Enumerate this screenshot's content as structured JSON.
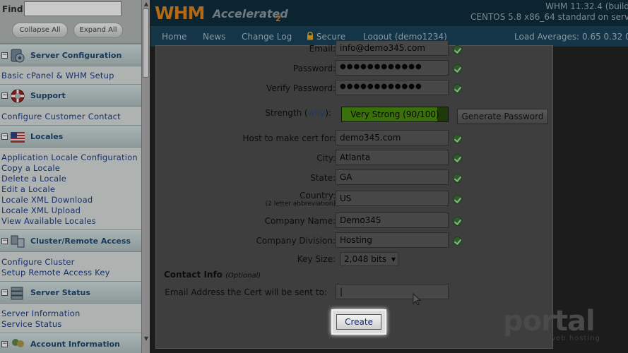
{
  "sidebar": {
    "find_label": "Find",
    "find_value": "",
    "collapse_all": "Collapse All",
    "expand_all": "Expand All",
    "sections": [
      {
        "title": "Server Configuration",
        "icon": "server-config-icon",
        "links": [
          "Basic cPanel & WHM Setup"
        ]
      },
      {
        "title": "Support",
        "icon": "lifebuoy-icon",
        "links": [
          "Configure Customer Contact"
        ]
      },
      {
        "title": "Locales",
        "icon": "us-flag-icon",
        "links": [
          "Application Locale Configuration",
          "Copy a Locale",
          "Delete a Locale",
          "Edit a Locale",
          "Locale XML Download",
          "Locale XML Upload",
          "View Available Locales"
        ]
      },
      {
        "title": "Cluster/Remote Access",
        "icon": "cluster-icon",
        "links": [
          "Configure Cluster",
          "Setup Remote Access Key"
        ]
      },
      {
        "title": "Server Status",
        "icon": "server-status-icon",
        "links": [
          "Server Information",
          "Service Status"
        ]
      },
      {
        "title": "Account Information",
        "icon": "account-info-icon",
        "links": []
      }
    ]
  },
  "header": {
    "logo_main": "WHM",
    "logo_sub": "Accelerated",
    "logo_num": "2",
    "version_line1": "WHM 11.32.4 (build",
    "version_line2": "CENTOS 5.8 x86_64 standard on serv"
  },
  "nav": {
    "items": [
      "Home",
      "News",
      "Change Log",
      "Secure",
      "Logout (demo1234)"
    ],
    "load_averages": "Load Averages: 0.65 0.32 0"
  },
  "form": {
    "email_label": "Email:",
    "email_value": "info@demo345.com",
    "password_label": "Password:",
    "password_value": "●●●●●●●●●●●●",
    "verify_label": "Verify Password:",
    "verify_value": "●●●●●●●●●●●●",
    "strength_label": "Strength (",
    "strength_why": "why",
    "strength_close": "):",
    "strength_text": "Very Strong (90/100)",
    "strength_level": 0.9,
    "generate_button": "Generate Password",
    "host_label": "Host to make cert for:",
    "host_value": "demo345.com",
    "city_label": "City:",
    "city_value": "Atlanta",
    "state_label": "State:",
    "state_value": "GA",
    "country_label": "Country:",
    "country_note": "(2 letter abbreviation)",
    "country_value": "US",
    "company_label": "Company Name:",
    "company_value": "Demo345",
    "division_label": "Company Division:",
    "division_value": "Hosting",
    "keysize_label": "Key Size:",
    "keysize_value": "2,048 bits",
    "contact_title": "Contact Info",
    "contact_optional": "(Optional)",
    "cert_email_label": "Email Address the Cert will be sent to:",
    "cert_email_value": "|",
    "create_button": "Create"
  },
  "watermark": {
    "brand": "portal",
    "tagline": "web hosting"
  },
  "colors": {
    "header_bg": "#0c2330",
    "nav_bg": "#143447",
    "strength_green": "#3a6f0b",
    "logo_orange": "#b26a16"
  }
}
